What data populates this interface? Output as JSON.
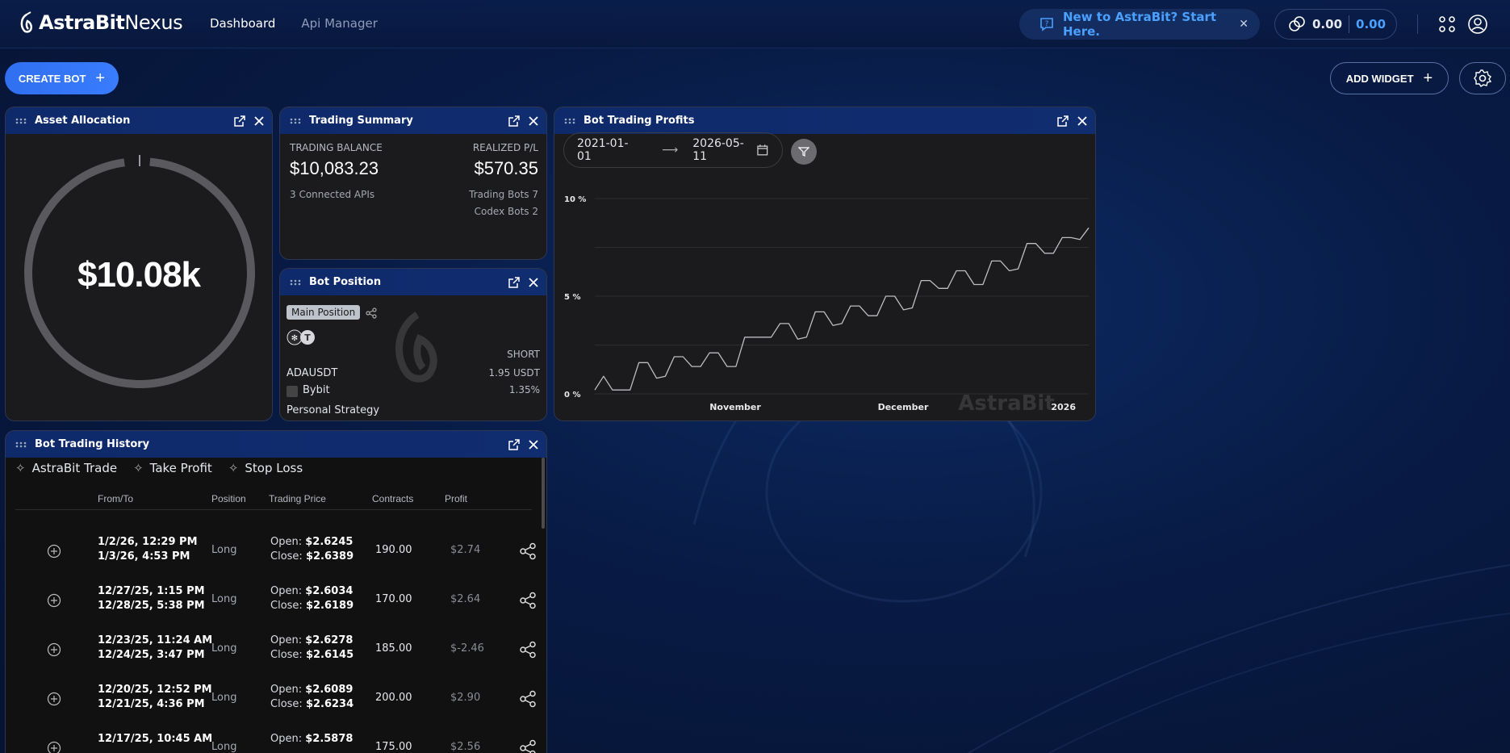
{
  "brand": {
    "name_bold": "AstraBit",
    "name_light": "Nexus"
  },
  "nav": {
    "dashboard": "Dashboard",
    "api_manager": "Api Manager"
  },
  "promo": {
    "text": "New to AstraBit? Start Here."
  },
  "wallet": {
    "value1": "0.00",
    "value2": "0.00"
  },
  "actions": {
    "create_bot": "CREATE BOT",
    "add_widget": "ADD WIDGET"
  },
  "asset_allocation": {
    "title": "Asset Allocation",
    "value": "$10.08k"
  },
  "trading_summary": {
    "title": "Trading Summary",
    "balance_label": "TRADING BALANCE",
    "balance_value": "$10,083.23",
    "pl_label": "REALIZED P/L",
    "pl_value": "$570.35",
    "connected": "3 Connected APIs",
    "trading_bots": "Trading Bots 7",
    "codex_bots": "Codex Bots 2"
  },
  "bot_position": {
    "title": "Bot Position",
    "tag": "Main Position",
    "side": "SHORT",
    "pair": "ADAUSDT",
    "amount": "1.95 USDT",
    "exchange": "Bybit",
    "pct": "1.35%",
    "strategy": "Personal Strategy"
  },
  "bot_profits": {
    "title": "Bot Trading Profits",
    "date_from": "2021-01-01",
    "date_to": "2026-05-11",
    "watermark": "AstraBit"
  },
  "chart_data": {
    "type": "line",
    "y_ticks": [
      "10 %",
      "5 %",
      "0 %"
    ],
    "x_ticks": [
      "November",
      "December",
      "2026"
    ],
    "ylim": [
      0,
      10
    ],
    "series": [
      {
        "points": [
          [
            0,
            0.2
          ],
          [
            1,
            0.9
          ],
          [
            2,
            0.2
          ],
          [
            3,
            0.2
          ],
          [
            4,
            0.2
          ],
          [
            5,
            1.6
          ],
          [
            6,
            1.6
          ],
          [
            7,
            0.8
          ],
          [
            8,
            0.9
          ],
          [
            9,
            1.9
          ],
          [
            10,
            1.9
          ],
          [
            11,
            1.4
          ],
          [
            12,
            1.4
          ],
          [
            13,
            2.1
          ],
          [
            14,
            2.1
          ],
          [
            15,
            1.4
          ],
          [
            16,
            1.4
          ],
          [
            17,
            2.9
          ],
          [
            18,
            2.9
          ],
          [
            19,
            2.9
          ],
          [
            20,
            2.9
          ],
          [
            21,
            3.6
          ],
          [
            22,
            3.6
          ],
          [
            23,
            2.8
          ],
          [
            24,
            2.9
          ],
          [
            25,
            4.2
          ],
          [
            26,
            4.2
          ],
          [
            27,
            3.5
          ],
          [
            28,
            3.6
          ],
          [
            29,
            4.5
          ],
          [
            30,
            4.5
          ],
          [
            31,
            4.0
          ],
          [
            32,
            4.0
          ],
          [
            33,
            5.0
          ],
          [
            34,
            5.0
          ],
          [
            35,
            4.3
          ],
          [
            36,
            4.4
          ],
          [
            37,
            5.8
          ],
          [
            38,
            5.8
          ],
          [
            39,
            5.4
          ],
          [
            40,
            5.4
          ],
          [
            41,
            6.3
          ],
          [
            42,
            6.3
          ],
          [
            43,
            5.6
          ],
          [
            44,
            5.6
          ],
          [
            45,
            6.8
          ],
          [
            46,
            6.8
          ],
          [
            47,
            6.3
          ],
          [
            48,
            6.4
          ],
          [
            49,
            7.7
          ],
          [
            50,
            7.7
          ],
          [
            51,
            7.2
          ],
          [
            52,
            7.2
          ],
          [
            53,
            8.0
          ],
          [
            54,
            8.0
          ],
          [
            55,
            7.9
          ],
          [
            56,
            8.5
          ]
        ]
      }
    ]
  },
  "history": {
    "title": "Bot Trading History",
    "tabs": [
      "AstraBit Trade",
      "Take Profit",
      "Stop Loss"
    ],
    "columns": [
      "From/To",
      "Position",
      "Trading Price",
      "Contracts",
      "Profit"
    ],
    "open_label": "Open: ",
    "close_label": "Close: ",
    "rows": [
      {
        "from": "1/2/26, 12:29 PM",
        "to": "1/3/26, 4:53 PM",
        "position": "Long",
        "open": "$2.6245",
        "close": "$2.6389",
        "contracts": "190.00",
        "profit": "$2.74"
      },
      {
        "from": "12/27/25, 1:15 PM",
        "to": "12/28/25, 5:38 PM",
        "position": "Long",
        "open": "$2.6034",
        "close": "$2.6189",
        "contracts": "170.00",
        "profit": "$2.64"
      },
      {
        "from": "12/23/25, 11:24 AM",
        "to": "12/24/25, 3:47 PM",
        "position": "Long",
        "open": "$2.6278",
        "close": "$2.6145",
        "contracts": "185.00",
        "profit": "$-2.46"
      },
      {
        "from": "12/20/25, 12:52 PM",
        "to": "12/21/25, 4:36 PM",
        "position": "Long",
        "open": "$2.6089",
        "close": "$2.6234",
        "contracts": "200.00",
        "profit": "$2.90"
      },
      {
        "from": "12/17/25, 10:45 AM",
        "to": "",
        "position": "Long",
        "open": "$2.5878",
        "close": "",
        "contracts": "175.00",
        "profit": "$2.56"
      }
    ]
  }
}
